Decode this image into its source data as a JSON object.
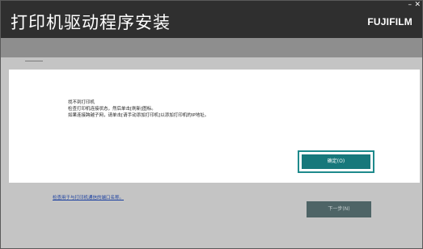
{
  "window": {
    "title": "打印机驱动程序安装",
    "brand": "FUJIFILM",
    "minimize_glyph": "–",
    "close_glyph": "✕"
  },
  "dialog": {
    "lines": [
      "找不到打印机",
      "检查打印机连接状态，然后单击[刷新]图标。",
      "如果连接跨越子网，请单击[请手动添加打印机]以添加打印机的IP地址。"
    ],
    "ok_label": "确定(O)"
  },
  "footer": {
    "link_text": "检查用于与打印机通信的端口名称。",
    "next_label": "下一步(N)"
  },
  "colors": {
    "titlebar": "#2f2f2f",
    "accent_teal": "#17787b",
    "next_button_disabled": "#4e6466",
    "link_blue": "#1a3fa0"
  }
}
